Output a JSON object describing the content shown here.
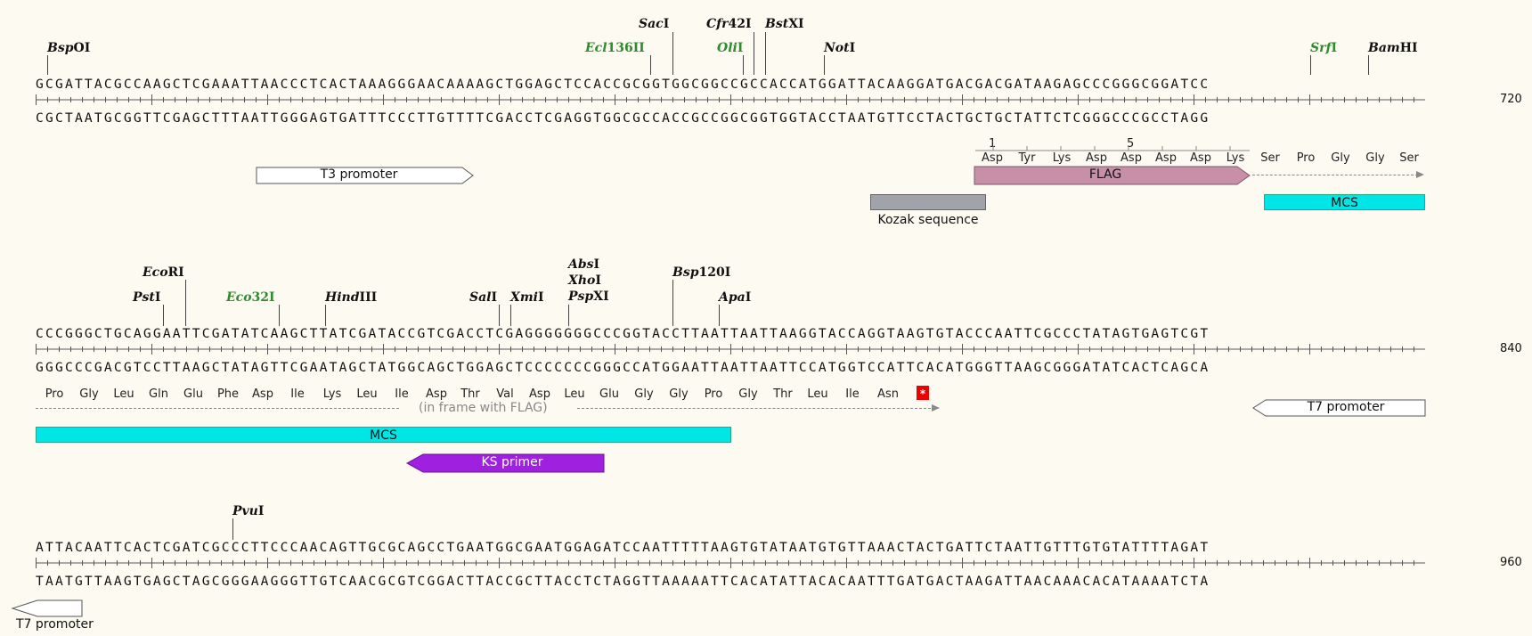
{
  "blocks": [
    {
      "top_strand": "GCGATTACGCCAAGCTCGAAATTAACCCTCACTAAAGGGAACAAAAGCTGGAGCTCCACCGCGGTGGCGGCCGCCACCATGGATTACAAGGATGACGACGATAAGAGCCCGGGCGGATCC",
      "bottom_strand": "CGCTAATGCGGTTCGAGCTTTAATTGGGAGTGATTTCCCTTGTTTTCGACCTCGAGGTGGCGCCACCGCCGGCGGTGGTACCTAATGTTCCTACTGCTGCTATTCTCGGGCCCGCCTAGG",
      "end_position": "720",
      "sites": [
        {
          "prefix": "Bsp",
          "suffix": "OI"
        },
        {
          "prefix": "Ecl",
          "suffix": "136II"
        },
        {
          "prefix": "Sac",
          "suffix": "I"
        },
        {
          "prefix": "Cfr",
          "suffix": "42I"
        },
        {
          "prefix": "Oli",
          "suffix": "I"
        },
        {
          "prefix": "Bst",
          "suffix": "XI"
        },
        {
          "prefix": "Not",
          "suffix": "I"
        },
        {
          "prefix": "Srf",
          "suffix": "I"
        },
        {
          "prefix": "Bam",
          "suffix": "HI"
        }
      ],
      "aa_numbers": [
        "1",
        "5"
      ],
      "translation": [
        "Asp",
        "Tyr",
        "Lys",
        "Asp",
        "Asp",
        "Asp",
        "Asp",
        "Lys",
        "Ser",
        "Pro",
        "Gly",
        "Gly",
        "Ser"
      ],
      "features": {
        "t3_promoter": "T3 promoter",
        "flag": "FLAG",
        "kozak": "Kozak sequence",
        "mcs": "MCS"
      }
    },
    {
      "top_strand": "CCCGGGCTGCAGGAATTCGATATCAAGCTTATCGATACCGTCGACCTCGAGGGGGGGCCCGGTACCTTAATTAATTAAGGTACCAGGTAAGTGTACCCAATTCGCCCTATAGTGAGTCGT",
      "bottom_strand": "GGGCCCGACGTCCTTAAGCTATAGTTCGAATAGCTATGGCAGCTGGAGCTCCCCCCCGGGCCATGGAATTAATTAATTCCATGGTCCATTCACATGGGTTAAGCGGGATATCACTCAGCA",
      "end_position": "840",
      "sites": [
        {
          "prefix": "Eco",
          "suffix": "RI"
        },
        {
          "prefix": "Pst",
          "suffix": "I"
        },
        {
          "prefix": "Eco",
          "suffix": "32I"
        },
        {
          "prefix": "Hind",
          "suffix": "III"
        },
        {
          "prefix": "Sal",
          "suffix": "I"
        },
        {
          "prefix": "Xmi",
          "suffix": "I"
        },
        {
          "prefix": "Abs",
          "suffix": "I"
        },
        {
          "prefix": "Xho",
          "suffix": "I"
        },
        {
          "prefix": "Psp",
          "suffix": "XI"
        },
        {
          "prefix": "Bsp",
          "suffix": "120I"
        },
        {
          "prefix": "Apa",
          "suffix": "I"
        }
      ],
      "translation": [
        "Pro",
        "Gly",
        "Leu",
        "Gln",
        "Glu",
        "Phe",
        "Asp",
        "Ile",
        "Lys",
        "Leu",
        "Ile",
        "Asp",
        "Thr",
        "Val",
        "Asp",
        "Leu",
        "Glu",
        "Gly",
        "Gly",
        "Pro",
        "Gly",
        "Thr",
        "Leu",
        "Ile",
        "Asn"
      ],
      "stop_symbol": "*",
      "frame_note": "(in frame with FLAG)",
      "features": {
        "t7_promoter": "T7 promoter",
        "mcs": "MCS",
        "ks_primer": "KS primer"
      }
    },
    {
      "top_strand": "ATTACAATTCACTCGATCGCCCTTCCCAACAGTTGCGCAGCCTGAATGGCGAATGGAGATCCAATTTTTAAGTGTATAATGTGTTAAACTACTGATTCTAATTGTTTGTGTATTTTAGAT",
      "bottom_strand": "TAATGTTAAGTGAGCTAGCGGGAAGGGTTGTCAACGCGTCGGACTTACCGCTTACCTCTAGGTTAAAAATTCACATATTACACAATTTGATGACTAAGATTAACAAACACATAAAATCTA",
      "end_position": "960",
      "sites": [
        {
          "prefix": "Pvu",
          "suffix": "I"
        }
      ],
      "features": {
        "t7_promoter": "T7 promoter"
      }
    }
  ],
  "colors": {
    "background": "#fdfaf2",
    "green_site": "#2e8b2e",
    "mcs": "#00e5e5",
    "flag": "#c88fa8",
    "kozak": "#a0a4aa",
    "ks_primer": "#a020e0",
    "stop": "#ee0000"
  }
}
